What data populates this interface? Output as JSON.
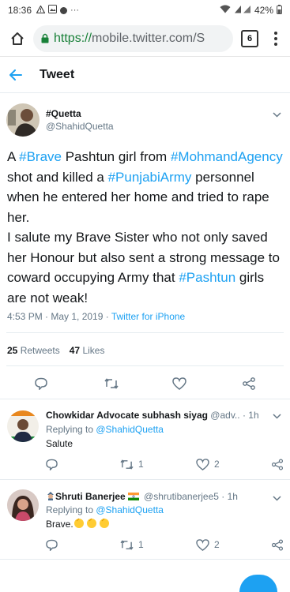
{
  "status_bar": {
    "time": "18:36",
    "battery": "42%"
  },
  "browser": {
    "url_secure_part": "https://",
    "url_domain": "mobile.twitter.com",
    "url_rest": "/S",
    "tab_count": "6"
  },
  "header": {
    "title": "Tweet"
  },
  "tweet": {
    "display_name": "#Quetta",
    "handle": "@ShahidQuetta",
    "text_segments": [
      {
        "t": "A ",
        "tag": false
      },
      {
        "t": "#Brave",
        "tag": true
      },
      {
        "t": " Pashtun girl from ",
        "tag": false
      },
      {
        "t": "#MohmandAgency",
        "tag": true
      },
      {
        "t": " shot and killed a ",
        "tag": false
      },
      {
        "t": "#PunjabiArmy",
        "tag": true
      },
      {
        "t": " personnel when he entered her home and tried to rape her.",
        "tag": false
      },
      {
        "t": "\nI salute my Brave Sister who not only saved her Honour but also sent a strong message to coward occupying Army that ",
        "tag": false
      },
      {
        "t": "#Pashtun",
        "tag": true
      },
      {
        "t": " girls are not weak!",
        "tag": false
      }
    ],
    "timestamp": "4:53 PM · May 1, 2019 · ",
    "source": "Twitter for iPhone",
    "retweets_count": "25",
    "retweets_label": "Retweets",
    "likes_count": "47",
    "likes_label": "Likes"
  },
  "replies": [
    {
      "display_name": "Chowkidar Advocate subhash siyag",
      "handle": "@adv..",
      "time": " · 1h",
      "replying_prefix": "Replying to ",
      "replying_to": "@ShahidQuetta",
      "text": "Salute",
      "retweets": "1",
      "likes": "2"
    },
    {
      "display_name": "Shruti Banerjee",
      "handle": "@shrutibanerjee5",
      "time": " · 1h",
      "replying_prefix": "Replying to ",
      "replying_to": "@ShahidQuetta",
      "text": "Brave.",
      "retweets": "1",
      "likes": "2"
    }
  ],
  "colors": {
    "accent": "#1da1f2",
    "secondary_text": "#657786",
    "url_green": "#188038"
  }
}
